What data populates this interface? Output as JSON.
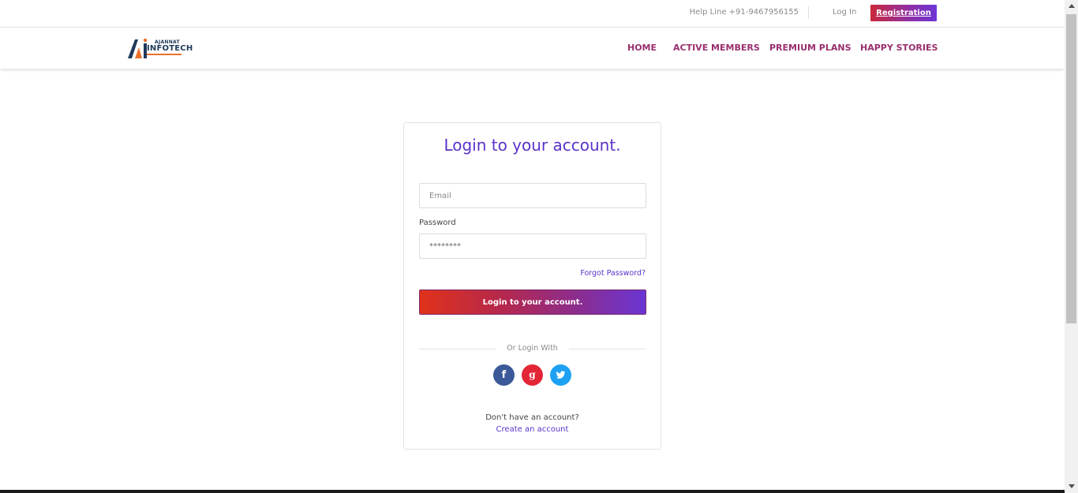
{
  "topbar": {
    "helpline": "Help Line +91-9467956155",
    "login_label": "Log In",
    "registration_label": "Registration"
  },
  "logo": {
    "top_text": "AJANNAT",
    "main_text": "INFOTECH"
  },
  "nav": {
    "items": [
      {
        "label": "HOME"
      },
      {
        "label": "ACTIVE MEMBERS"
      },
      {
        "label": "PREMIUM PLANS"
      },
      {
        "label": "HAPPY STORIES"
      }
    ]
  },
  "login_card": {
    "title": "Login to your account.",
    "email_placeholder": "Email",
    "password_label": "Password",
    "password_value": "********",
    "forgot_label": "Forgot Password?",
    "submit_label": "Login to your account.",
    "or_login_with": "Or Login With",
    "social": [
      {
        "icon": "facebook-icon",
        "glyph": "f",
        "color": "#3b5998"
      },
      {
        "icon": "google-icon",
        "glyph": "g",
        "color": "#e32636"
      },
      {
        "icon": "twitter-icon",
        "glyph": "",
        "color": "#1da1f2"
      }
    ],
    "no_account_text": "Don't have an account?",
    "create_account_label": "Create an account"
  },
  "colors": {
    "accent_purple": "#5a33c9",
    "nav_text": "#9a2f6e",
    "gradient_start": "#e0321a",
    "gradient_end": "#6a35d4"
  }
}
